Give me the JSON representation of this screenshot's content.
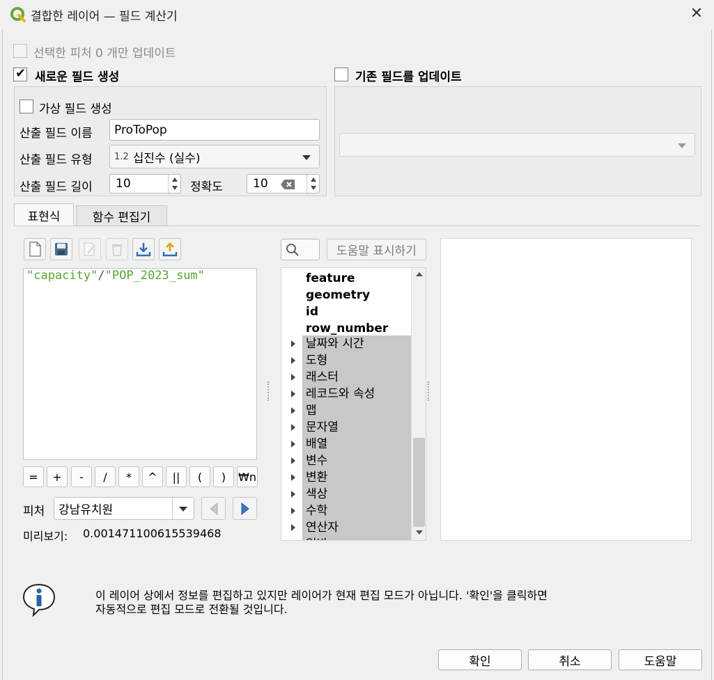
{
  "window": {
    "title": "결합한 레이어 — 필드 계산기"
  },
  "update_selected": {
    "label": "선택한 피처 0 개만 업데이트"
  },
  "create_field": {
    "label": "새로운 필드 생성",
    "checked": true
  },
  "update_existing": {
    "label": "기존 필드를 업데이트",
    "checked": false
  },
  "virtual_field": {
    "label": "가상 필드 생성"
  },
  "output_name": {
    "label": "산출 필드 이름",
    "value": "ProToPop"
  },
  "output_type": {
    "label": "산출 필드 유형",
    "prefix": "1.2",
    "value": "십진수 (실수)"
  },
  "output_length": {
    "label": "산출 필드 길이",
    "value": "10"
  },
  "precision": {
    "label": "정확도",
    "value": "10"
  },
  "tabs": [
    {
      "label": "표현식"
    },
    {
      "label": "함수 편집기"
    }
  ],
  "expression": {
    "field1": "\"capacity\"",
    "operator": "/",
    "field2": "\"POP_2023_sum\""
  },
  "operators": [
    "=",
    "+",
    "-",
    "/",
    "*",
    "^",
    "||",
    "(",
    ")",
    "₩n"
  ],
  "feature": {
    "label": "피처",
    "value": "강남유치원"
  },
  "preview": {
    "label": "미리보기:",
    "value": "0.001471100615539468"
  },
  "search": {
    "placeholder": ""
  },
  "help_button": {
    "label": "도움말 표시하기"
  },
  "tree": {
    "variables": [
      "feature",
      "geometry",
      "id",
      "row_number"
    ],
    "groups": [
      "날짜와 시간",
      "도형",
      "래스터",
      "레코드와 속성",
      "맵",
      "문자열",
      "배열",
      "변수",
      "변환",
      "색상",
      "수학",
      "연산자",
      "일반"
    ]
  },
  "info": {
    "line1": "이 레이어 상에서 정보를 편집하고 있지만 레이어가 현재 편집 모드가 아닙니다. '확인'을 클릭하면",
    "line2": "자동적으로 편집 모드로 전환될 것입니다."
  },
  "buttons": {
    "ok": "확인",
    "cancel": "취소",
    "help": "도움말"
  },
  "colors": {
    "field_green": "#55a630",
    "operator_gray": "#555555",
    "accent_blue": "#2d6fb6",
    "qgis_green": "#6ba539"
  }
}
